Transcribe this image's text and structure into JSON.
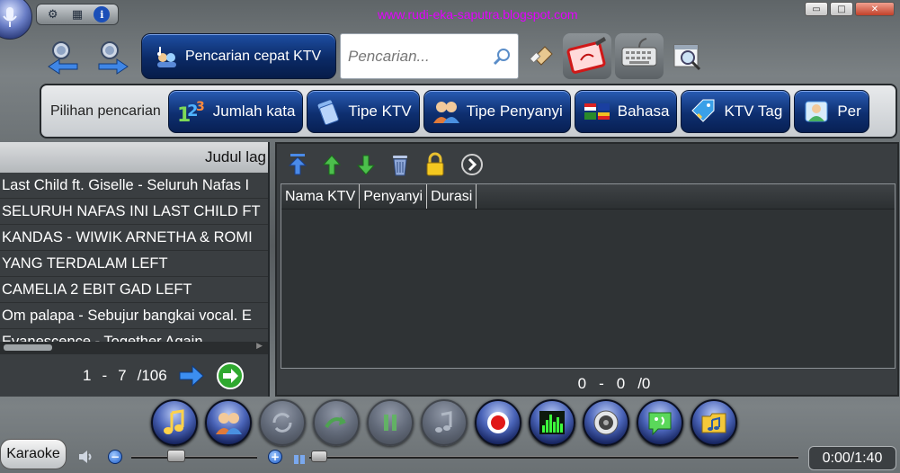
{
  "header": {
    "website": "www.rudi-eka-saputra.blogspot.com",
    "top_icons": [
      "gear-icon",
      "film-icon",
      "info-icon"
    ],
    "info_glyph": "i",
    "window_buttons": {
      "minimize": "▭",
      "maximize": "□",
      "close": "✕"
    }
  },
  "toolbar": {
    "quick_search_label": "Pencarian cepat KTV",
    "search_placeholder": "Pencarian..."
  },
  "filters": {
    "label": "Pilihan pencarian",
    "buttons": [
      {
        "label": "Jumlah kata",
        "icon": "numbers-icon"
      },
      {
        "label": "Tipe KTV",
        "icon": "ktv-type-icon"
      },
      {
        "label": "Tipe Penyanyi",
        "icon": "singers-icon"
      },
      {
        "label": "Bahasa",
        "icon": "flags-icon"
      },
      {
        "label": "KTV Tag",
        "icon": "tag-icon"
      },
      {
        "label": "Per",
        "icon": "person-icon"
      }
    ]
  },
  "song_list": {
    "header": "Judul lag",
    "items": [
      "Last Child ft. Giselle - Seluruh Nafas I",
      "SELURUH NAFAS INI LAST CHILD FT",
      "KANDAS - WIWIK ARNETHA & ROMI",
      "YANG TERDALAM LEFT",
      "CAMELIA 2 EBIT GAD LEFT",
      "Om palapa - Sebujur bangkai vocal. E",
      "Evanescence - Together Again"
    ],
    "pager": {
      "start": "1",
      "sep": "-",
      "end": "7",
      "total": "/106"
    }
  },
  "playlist": {
    "columns": [
      "Nama KTV",
      "Penyanyi",
      "Durasi"
    ],
    "pager": {
      "start": "0",
      "sep": "-",
      "end": "0",
      "total": "/0"
    }
  },
  "player": {
    "karaoke_label": "Karaoke",
    "time": "0:00/1:40",
    "volume_level": 0.3,
    "seek_position": 0.0
  }
}
